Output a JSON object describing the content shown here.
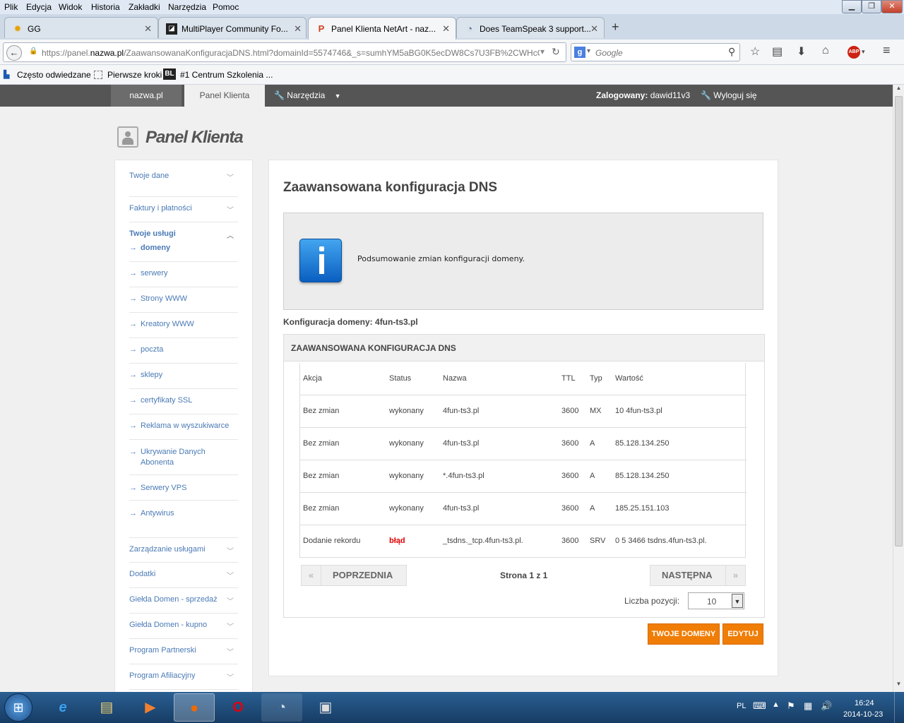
{
  "browser": {
    "menu": [
      "Plik",
      "Edycja",
      "Widok",
      "Historia",
      "Zakładki",
      "Narzędzia",
      "Pomoc"
    ],
    "tabs": [
      {
        "title": "GG",
        "icon": "gg-sun-icon"
      },
      {
        "title": "MultiPlayer Community Fo...",
        "icon": "mp-icon"
      },
      {
        "title": "Panel Klienta NetArt - naz...",
        "icon": "netart-icon"
      },
      {
        "title": "Does TeamSpeak 3 support...",
        "icon": "teamspeak-icon"
      }
    ],
    "new_tab": "+",
    "url_prefix": "https://panel.",
    "url_domain": "nazwa.pl",
    "url_rest": "/ZaawansowanaKonfiguracjaDNS.html?domainId=5574746&_s=sumhYM5aBG0K5ecDW8Cs7U3FB%2CWHcOC",
    "search_placeholder": "Google",
    "bookmarks": [
      "Często odwiedzane",
      "Pierwsze kroki",
      "#1 Centrum Szkolenia ..."
    ],
    "bookmark_icon_text": "BL",
    "abp": "ABP"
  },
  "topnav": {
    "site": "nazwa.pl",
    "panel": "Panel Klienta",
    "tools": "Narzędzia",
    "logged_label": "Zalogowany:",
    "logged_user": "dawid11v3",
    "logout": "Wyloguj się"
  },
  "logo": "Panel Klienta",
  "sidebar": {
    "top": [
      "Twoje dane",
      "Faktury i płatności",
      "Twoje usługi"
    ],
    "services": [
      "domeny",
      "serwery",
      "Strony WWW",
      "Kreatory WWW",
      "poczta",
      "sklepy",
      "certyfikaty SSL",
      "Reklama w wyszukiwarce",
      "Ukrywanie Danych Abonenta",
      "Serwery VPS",
      "Antywirus"
    ],
    "bottom": [
      "Zarządzanie usługami",
      "Dodatki",
      "Giełda Domen - sprzedaż",
      "Giełda Domen - kupno",
      "Program Partnerski",
      "Program Afiliacyjny"
    ]
  },
  "main": {
    "title": "Zaawansowana konfiguracja DNS",
    "info": "Podsumowanie zmian konfiguracji domeny.",
    "domain_label": "Konfiguracja domeny: 4fun-ts3.pl",
    "table_title": "ZAAWANSOWANA KONFIGURACJA DNS",
    "headers": [
      "Akcja",
      "Status",
      "Nazwa",
      "TTL",
      "Typ",
      "Wartość"
    ],
    "rows": [
      [
        "Bez zmian",
        "wykonany",
        "4fun-ts3.pl",
        "3600",
        "MX",
        "10 4fun-ts3.pl"
      ],
      [
        "Bez zmian",
        "wykonany",
        "4fun-ts3.pl",
        "3600",
        "A",
        "85.128.134.250"
      ],
      [
        "Bez zmian",
        "wykonany",
        "*.4fun-ts3.pl",
        "3600",
        "A",
        "85.128.134.250"
      ],
      [
        "Bez zmian",
        "wykonany",
        "4fun-ts3.pl",
        "3600",
        "A",
        "185.25.151.103"
      ],
      [
        "Dodanie rekordu",
        "błąd",
        "_tsdns._tcp.4fun-ts3.pl.",
        "3600",
        "SRV",
        "0 5 3466 tsdns.4fun-ts3.pl."
      ]
    ],
    "prev": "POPRZEDNIA",
    "next": "NASTĘPNA",
    "page": "Strona 1 z 1",
    "per_page_label": "Liczba pozycji:",
    "per_page": "10",
    "btn_domains": "TWOJE DOMENY",
    "btn_edit": "EDYTUJ",
    "error_color": "#e00000",
    "accent": "#f07d05"
  },
  "taskbar": {
    "lang": "PL",
    "time": "16:24",
    "date": "2014-10-23"
  }
}
